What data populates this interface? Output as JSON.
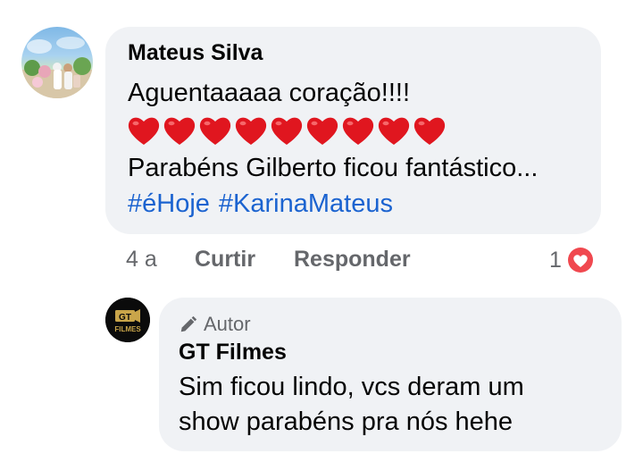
{
  "comment": {
    "author": "Mateus Silva",
    "text_line1": "Aguentaaaaa coração!!!!",
    "hearts_count": 9,
    "text_line3": "Parabéns Gilberto ficou fantástico...",
    "hashtags": [
      "#éHoje",
      "#KarinaMateus"
    ],
    "time": "4 a",
    "like_label": "Curtir",
    "reply_label": "Responder",
    "reaction_count": "1",
    "hashtag_color": "#1b63d0",
    "heart_color": "#e0161f",
    "reaction_color": "#f0484f"
  },
  "reply": {
    "badge_icon": "pencil-icon",
    "badge_label": "Autor",
    "author": "GT Filmes",
    "text_line1": "Sim ficou lindo, vcs deram um",
    "text_line2": "show parabéns pra nós hehe",
    "avatar_logo": {
      "top": "GT",
      "bottom": "FILMES"
    }
  }
}
